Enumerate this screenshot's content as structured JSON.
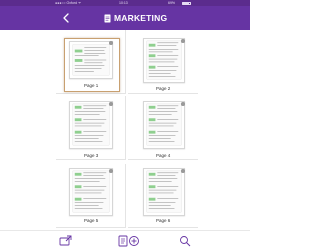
{
  "status_bar": {
    "carrier": "●●●○○ Oxford ᯤ",
    "time": "10:13",
    "battery_text": "69%"
  },
  "header": {
    "title": "MARKETING",
    "back_icon": "chevron-left-icon",
    "doc_icon": "document-icon",
    "color": "#6634a3"
  },
  "pages": [
    {
      "label": "Page 1",
      "selected": true
    },
    {
      "label": "Page 2",
      "selected": false
    },
    {
      "label": "Page 3",
      "selected": false
    },
    {
      "label": "Page 4",
      "selected": false
    },
    {
      "label": "Page 5",
      "selected": false
    },
    {
      "label": "Page 6",
      "selected": false
    }
  ],
  "toolbar": {
    "left_icon": "export-icon",
    "center_left_icon": "document-icon",
    "center_right_icon": "add-page-icon",
    "right_icon": "search-icon"
  }
}
